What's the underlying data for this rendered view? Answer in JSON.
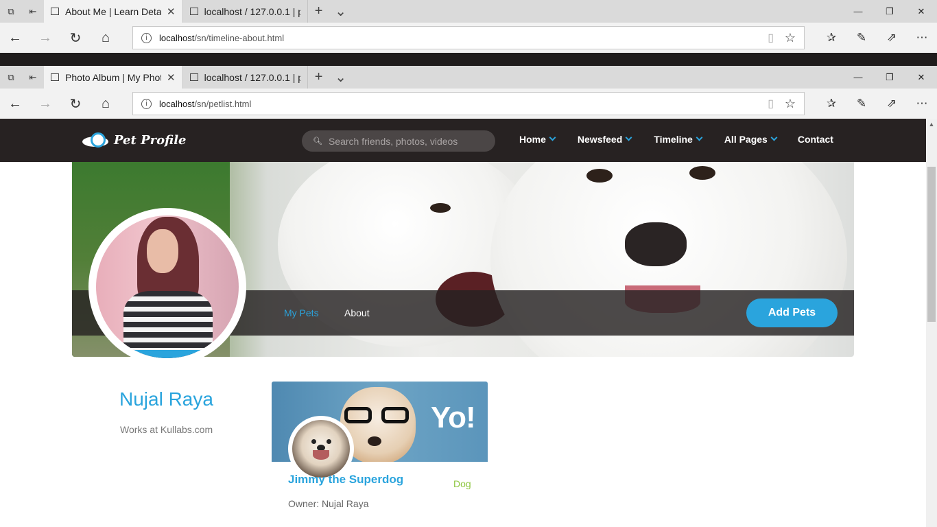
{
  "browser_back": {
    "tabs": [
      {
        "label": "About Me | Learn Detail",
        "active": true
      },
      {
        "label": "localhost / 127.0.0.1 | phpM",
        "active": false
      }
    ],
    "url_host": "localhost",
    "url_path": "/sn/timeline-about.html"
  },
  "browser_front": {
    "tabs": [
      {
        "label": "Photo Album | My Phot",
        "active": true
      },
      {
        "label": "localhost / 127.0.0.1 | phpM",
        "active": false
      }
    ],
    "url_host": "localhost",
    "url_path": "/sn/petlist.html"
  },
  "icons": {
    "tab_set_aside": "tabs-icon",
    "back": "back-arrow-icon",
    "forward": "forward-arrow-icon",
    "refresh": "refresh-icon",
    "home": "home-icon",
    "reading_view": "book-icon",
    "favorite": "star-icon",
    "hub": "favorites-hub-icon",
    "notes": "pen-icon",
    "share": "share-icon",
    "more": "more-icon"
  },
  "site": {
    "logo_text": "Pet Profile",
    "search_placeholder": "Search friends, photos, videos",
    "menu": [
      {
        "label": "Home",
        "dropdown": true
      },
      {
        "label": "Newsfeed",
        "dropdown": true
      },
      {
        "label": "Timeline",
        "dropdown": true
      },
      {
        "label": "All Pages",
        "dropdown": true
      },
      {
        "label": "Contact",
        "dropdown": false
      }
    ]
  },
  "timeline": {
    "my_pets": "My Pets",
    "about": "About",
    "add_pets": "Add Pets"
  },
  "profile": {
    "name": "Nujal Raya",
    "works": "Works at Kullabs.com"
  },
  "pet": {
    "cover_text": "Yo!",
    "name": "Jimmy the Superdog",
    "type": "Dog",
    "owner": "Owner: Nujal Raya"
  },
  "colors": {
    "accent": "#2aa4dd",
    "header_bg": "#272222",
    "pet_type": "#8dc63f"
  }
}
